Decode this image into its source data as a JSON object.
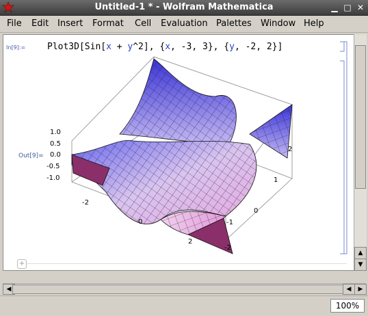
{
  "window": {
    "title": "Untitled-1 * - Wolfram Mathematica",
    "controls": {
      "minimize": "▁",
      "maximize": "□",
      "close": "✕"
    }
  },
  "menu": [
    {
      "label": "File",
      "acc": "F",
      "rest": "ile"
    },
    {
      "label": "Edit",
      "acc": "E",
      "rest": "dit"
    },
    {
      "label": "Insert",
      "acc": "I",
      "rest": "nsert"
    },
    {
      "label": "Format",
      "acc": "F",
      "rest": "ormat"
    },
    {
      "label": "Cell",
      "acc": "C",
      "rest": "ell"
    },
    {
      "label": "Evaluation",
      "acc": "E",
      "rest": "valuation"
    },
    {
      "label": "Palettes",
      "acc": "P",
      "rest": "alettes"
    },
    {
      "label": "Window",
      "acc": "W",
      "rest": "indow"
    },
    {
      "label": "Help",
      "acc": "H",
      "rest": "elp"
    }
  ],
  "notebook": {
    "input_label": "In[9]:=",
    "input_parts": [
      {
        "t": "Plot3D[Sin[",
        "v": false
      },
      {
        "t": "x",
        "v": true
      },
      {
        "t": " + ",
        "v": false
      },
      {
        "t": "y",
        "v": true
      },
      {
        "t": "^2], {",
        "v": false
      },
      {
        "t": "x",
        "v": true
      },
      {
        "t": ", -3, 3}, {",
        "v": false
      },
      {
        "t": "y",
        "v": true
      },
      {
        "t": ", -2, 2}]",
        "v": false
      }
    ],
    "output_label": "Out[9]=",
    "plot": {
      "z_ticks": [
        "1.0",
        "0.5",
        "0.0",
        "-0.5",
        "-1.0"
      ],
      "x_ticks": [
        "-2",
        "0",
        "2"
      ],
      "y_ticks": [
        "2",
        "1",
        "0",
        "-1",
        "-2"
      ]
    }
  },
  "status": {
    "zoom": "100%"
  }
}
